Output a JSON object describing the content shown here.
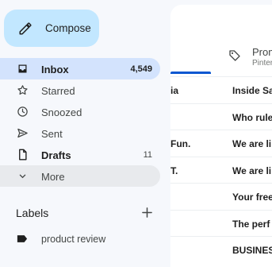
{
  "compose": {
    "label": "Compose",
    "icon": "pencil-icon"
  },
  "nav": {
    "items": [
      {
        "label": "Inbox",
        "count": "4,549",
        "icon": "inbox-icon"
      },
      {
        "label": "Starred",
        "count": "",
        "icon": "star-icon"
      },
      {
        "label": "Snoozed",
        "count": "",
        "icon": "clock-icon"
      },
      {
        "label": "Sent",
        "count": "",
        "icon": "send-icon"
      },
      {
        "label": "Drafts",
        "count": "11",
        "icon": "draft-icon"
      },
      {
        "label": "More",
        "count": "",
        "icon": "chevron-down-icon"
      }
    ]
  },
  "labels": {
    "heading": "Labels",
    "items": [
      {
        "label": "product review",
        "icon": "label-tag-icon"
      }
    ]
  },
  "tabs": {
    "promotions": {
      "title": "Prom",
      "subtitle": "Pinter"
    }
  },
  "emails": [
    {
      "sender": "ia",
      "subject": "Inside Sa"
    },
    {
      "sender": "",
      "subject": "Who rule"
    },
    {
      "sender": "Fun.",
      "subject": "We are li"
    },
    {
      "sender": "T.",
      "subject": "We are li"
    },
    {
      "sender": "",
      "subject": "Your free"
    },
    {
      "sender": "",
      "subject": "The perf"
    },
    {
      "sender": "",
      "subject": "BUSINES"
    }
  ],
  "colors": {
    "background": "#f6f8fc",
    "compose_bg": "#c2e7ff",
    "active_nav_bg": "#d3e3fd",
    "tab_accent": "#0b57d0"
  }
}
